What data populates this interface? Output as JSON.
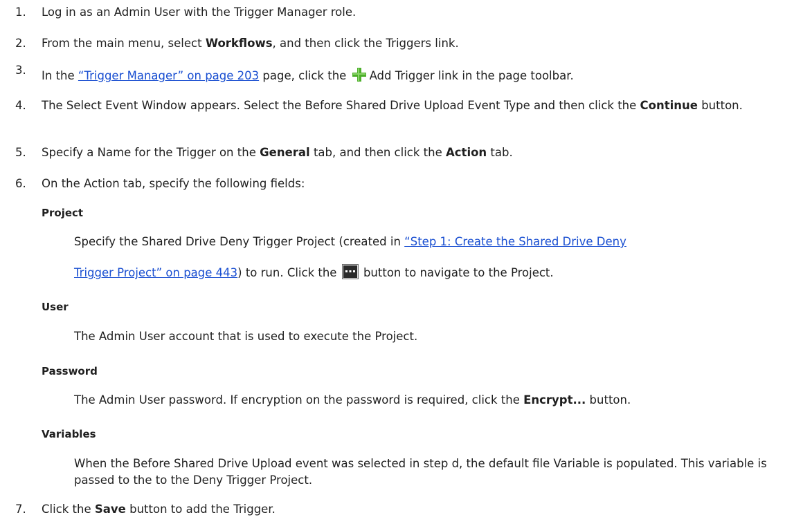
{
  "steps": {
    "s1": {
      "num": "1.",
      "text": "Log in as an Admin User with the Trigger Manager role."
    },
    "s2": {
      "num": "2.",
      "a": "From the main menu, select ",
      "b": "Workflows",
      "c": ", and then click the Triggers link."
    },
    "s3": {
      "num": "3.",
      "a": "In the ",
      "link": "“Trigger Manager” on page 203",
      "b": " page, click the ",
      "c": "Add Trigger link in the page toolbar."
    },
    "s4": {
      "num": "4.",
      "a": "The Select Event Window appears. Select the Before Shared Drive Upload Event Type and then click the ",
      "b": "Continue",
      "c": " button."
    },
    "s5": {
      "num": "5.",
      "a": "Specify a Name for the Trigger on the ",
      "b": "General",
      "c": " tab, and then click the ",
      "d": "Action",
      "e": " tab."
    },
    "s6": {
      "num": "6.",
      "text": "On the Action tab, specify the following fields:"
    },
    "s7": {
      "num": "7.",
      "a": "Click the ",
      "b": "Save",
      "c": " button to add the Trigger."
    }
  },
  "fields": {
    "project": {
      "label": "Project",
      "line1_a": "Specify the Shared Drive Deny Trigger Project (created in ",
      "line1_link": "“Step 1: Create the Shared Drive Deny",
      "line2_link": "Trigger Project” on page 443",
      "line2_a": ") to run. Click the ",
      "line2_b": " button to navigate to the Project."
    },
    "user": {
      "label": "User",
      "text": "The Admin User account that is used to execute the Project."
    },
    "password": {
      "label": "Password",
      "a": "The Admin User password. If encryption on the password is required, click the ",
      "b": "Encrypt...",
      "c": " button."
    },
    "variables": {
      "label": "Variables",
      "text": "When the Before Shared Drive Upload event was selected in step d, the default file Variable is populated. This variable is passed to the to the Deny Trigger Project."
    }
  },
  "icons": {
    "add": "plus-icon",
    "browse": "ellipsis-button-icon"
  },
  "colors": {
    "link": "#1a4fd1",
    "plus_green": "#4caf2a",
    "text": "#1f1f1f"
  }
}
